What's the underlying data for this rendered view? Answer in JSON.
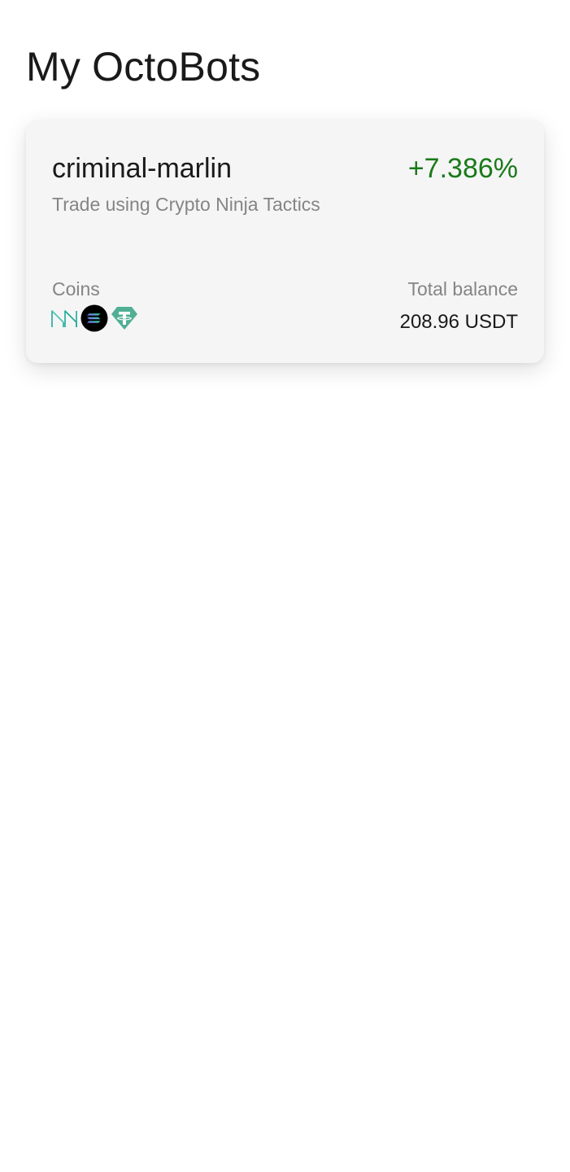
{
  "page": {
    "title": "My OctoBots"
  },
  "bots": [
    {
      "name": "criminal-marlin",
      "pnl": "+7.386%",
      "pnl_color": "#1a7a1a",
      "strategy": "Trade using Crypto Ninja Tactics",
      "coins_label": "Coins",
      "coins": [
        {
          "icon": "maker-mkr-icon",
          "color": "#1aab9b"
        },
        {
          "icon": "solana-sol-icon",
          "color": "#000000"
        },
        {
          "icon": "tether-usdt-icon",
          "color": "#50af95"
        }
      ],
      "balance_label": "Total balance",
      "balance_value": "208.96 USDT"
    }
  ]
}
